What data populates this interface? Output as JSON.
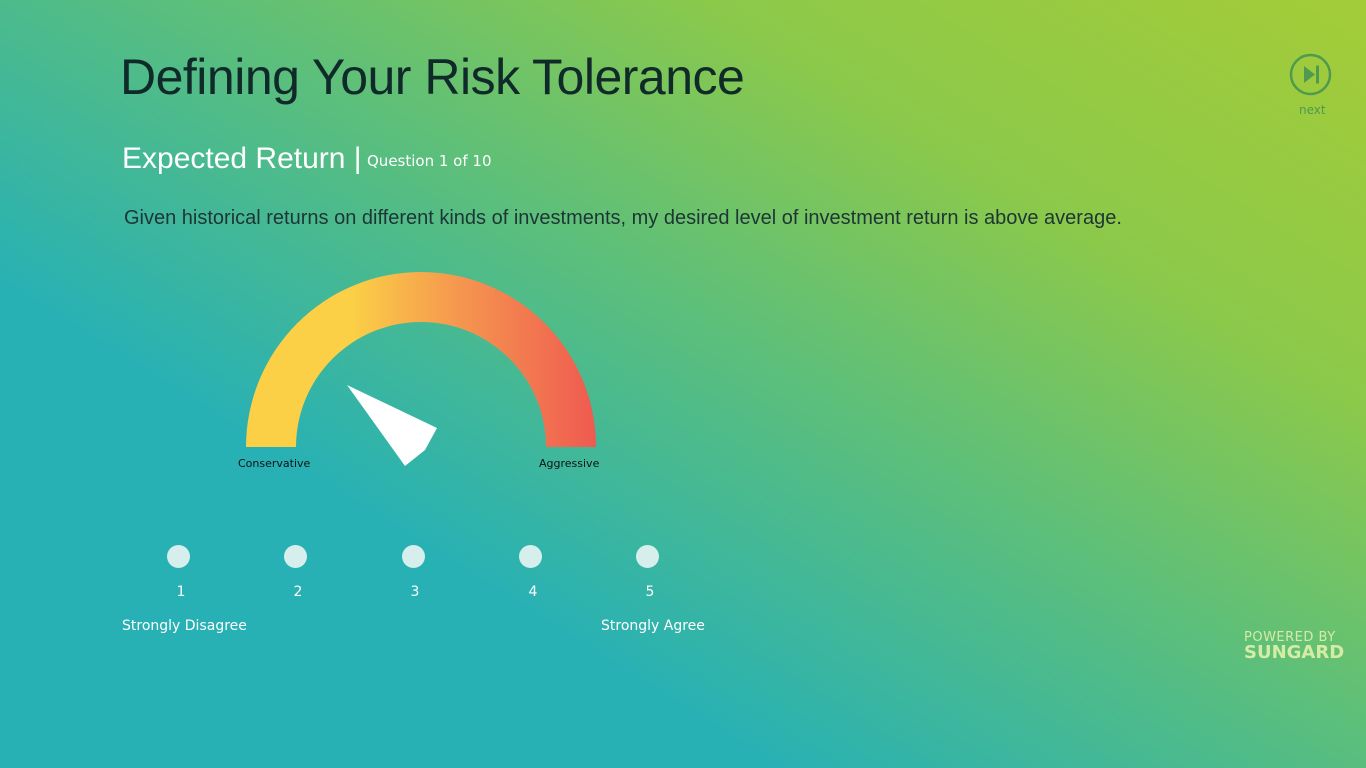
{
  "header": {
    "title": "Defining Your Risk Tolerance",
    "section": "Expected Return |",
    "question_count": "Question 1 of 10"
  },
  "question": "Given historical returns on different kinds of investments, my desired level of investment return is above average.",
  "gauge": {
    "min_label": "Conservative",
    "max_label": "Aggressive",
    "colors": [
      "#fbd046",
      "#f5a14e",
      "#ef5a50"
    ]
  },
  "scale": {
    "options": [
      "1",
      "2",
      "3",
      "4",
      "5"
    ],
    "min_label": "Strongly Disagree",
    "max_label": "Strongly Agree",
    "selected": null
  },
  "nav": {
    "next_label": "next",
    "next_icon": "skip-forward-icon"
  },
  "branding": {
    "powered_by": "POWERED BY",
    "brand": "SUNGARD"
  }
}
